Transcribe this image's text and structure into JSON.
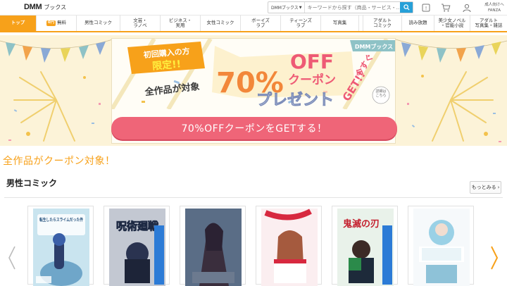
{
  "header": {
    "logo": "DMM",
    "logo_sub": "ブックス",
    "search": {
      "scope": "DMMブックス",
      "placeholder": "キーワードから探す（商品・サービス・…"
    },
    "adult_switch": [
      "成人向けへ",
      "FANZA"
    ]
  },
  "nav": {
    "items": [
      {
        "label": "トップ",
        "active": true
      },
      {
        "label": "無料",
        "badge": "0円"
      },
      {
        "label": "男性コミック"
      },
      {
        "label": "文芸・\nラノベ"
      },
      {
        "label": "ビジネス・\n実用"
      },
      {
        "label": "女性コミック"
      },
      {
        "label": "ボーイズ\nラブ"
      },
      {
        "label": "ティーンズ\nラブ"
      },
      {
        "label": "写真集"
      },
      {
        "label": "アダルト\nコミック"
      },
      {
        "label": "読み放題"
      },
      {
        "label": "美少女ノベル\n・官能小説"
      },
      {
        "label": "アダルト\n写真集・雑誌"
      }
    ]
  },
  "banner": {
    "badge_line1": "初回購入の方",
    "badge_line2": "限定!!",
    "all_items": "全作品が対象",
    "percent": "70%",
    "off": "OFF",
    "coupon": "クーポン",
    "present": "プレゼント",
    "now": "今すぐ",
    "get": "GET!!",
    "brand_tag": "DMMブックス",
    "details": "詳細は\nこちら",
    "cta": "70%OFFクーポンをGETする！"
  },
  "section": {
    "promo_heading": "全作品がクーポン対象！",
    "title": "男性コミック",
    "more": "もっとみる"
  },
  "books": [
    {
      "title": "転生したらスライムだった件"
    },
    {
      "title": "呪術廻戦"
    },
    {
      "title": ""
    },
    {
      "title": ""
    },
    {
      "title": "鬼滅の刃"
    },
    {
      "title": ""
    }
  ],
  "colors": {
    "accent": "#f7a11a",
    "cta": "#ef6578",
    "search": "#27a0d8",
    "banner_bg": "#fcf3d8"
  }
}
